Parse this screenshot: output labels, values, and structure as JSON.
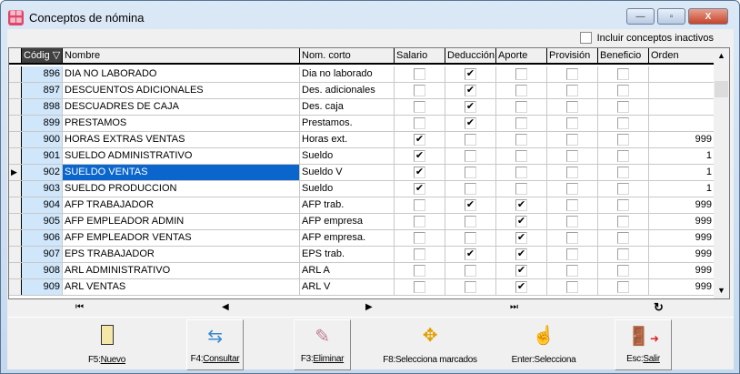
{
  "window": {
    "title": "Conceptos de nómina",
    "minimize": "—",
    "restore": "▫",
    "close": "X"
  },
  "filter": {
    "inactive_label": "Incluir conceptos inactivos",
    "inactive_checked": false
  },
  "grid": {
    "columns": [
      "Códig ▽",
      "Nombre",
      "Nom. corto",
      "Salario",
      "Deducción",
      "Aporte",
      "Provisión",
      "Beneficio",
      "Orden"
    ],
    "selected_code": "902",
    "rows": [
      {
        "code": "896",
        "name": "DIA NO LABORADO",
        "short": "Dia no laborado",
        "salario": false,
        "deduccion": true,
        "aporte": false,
        "provision": false,
        "beneficio": false,
        "orden": ""
      },
      {
        "code": "897",
        "name": "DESCUENTOS ADICIONALES",
        "short": "Des. adicionales",
        "salario": false,
        "deduccion": true,
        "aporte": false,
        "provision": false,
        "beneficio": false,
        "orden": ""
      },
      {
        "code": "898",
        "name": "DESCUADRES DE CAJA",
        "short": "Des. caja",
        "salario": false,
        "deduccion": true,
        "aporte": false,
        "provision": false,
        "beneficio": false,
        "orden": ""
      },
      {
        "code": "899",
        "name": "PRESTAMOS",
        "short": "Prestamos.",
        "salario": false,
        "deduccion": true,
        "aporte": false,
        "provision": false,
        "beneficio": false,
        "orden": ""
      },
      {
        "code": "900",
        "name": "HORAS EXTRAS VENTAS",
        "short": "Horas ext.",
        "salario": true,
        "deduccion": false,
        "aporte": false,
        "provision": false,
        "beneficio": false,
        "orden": "999"
      },
      {
        "code": "901",
        "name": "SUELDO ADMINISTRATIVO",
        "short": "Sueldo",
        "salario": true,
        "deduccion": false,
        "aporte": false,
        "provision": false,
        "beneficio": false,
        "orden": "1"
      },
      {
        "code": "902",
        "name": "SUELDO VENTAS",
        "short": "Sueldo V",
        "salario": true,
        "deduccion": false,
        "aporte": false,
        "provision": false,
        "beneficio": false,
        "orden": "1"
      },
      {
        "code": "903",
        "name": "SUELDO PRODUCCION",
        "short": "Sueldo",
        "salario": true,
        "deduccion": false,
        "aporte": false,
        "provision": false,
        "beneficio": false,
        "orden": "1"
      },
      {
        "code": "904",
        "name": "AFP TRABAJADOR",
        "short": "AFP trab.",
        "salario": false,
        "deduccion": true,
        "aporte": true,
        "provision": false,
        "beneficio": false,
        "orden": "999"
      },
      {
        "code": "905",
        "name": "AFP EMPLEADOR ADMIN",
        "short": "AFP empresa",
        "salario": false,
        "deduccion": false,
        "aporte": true,
        "provision": false,
        "beneficio": false,
        "orden": "999"
      },
      {
        "code": "906",
        "name": "AFP EMPLEADOR VENTAS",
        "short": "AFP empresa.",
        "salario": false,
        "deduccion": false,
        "aporte": true,
        "provision": false,
        "beneficio": false,
        "orden": "999"
      },
      {
        "code": "907",
        "name": "EPS TRABAJADOR",
        "short": "EPS trab.",
        "salario": false,
        "deduccion": true,
        "aporte": true,
        "provision": false,
        "beneficio": false,
        "orden": "999"
      },
      {
        "code": "908",
        "name": "ARL ADMINISTRATIVO",
        "short": "ARL A",
        "salario": false,
        "deduccion": false,
        "aporte": true,
        "provision": false,
        "beneficio": false,
        "orden": "999"
      },
      {
        "code": "909",
        "name": "ARL VENTAS",
        "short": "ARL V",
        "salario": false,
        "deduccion": false,
        "aporte": true,
        "provision": false,
        "beneficio": false,
        "orden": "999"
      }
    ]
  },
  "nav": {
    "first": "⏮",
    "prev": "◀",
    "next": "▶",
    "last": "⏭",
    "refresh": "↻"
  },
  "toolbar": {
    "nuevo": {
      "key": "F5:",
      "label": "Nuevo"
    },
    "consultar": {
      "key": "F4:",
      "label": "Consultar"
    },
    "eliminar": {
      "key": "F3:",
      "label": "Eliminar"
    },
    "marcados": "F8:Selecciona marcados",
    "selecciona": "Enter:Selecciona",
    "salir": {
      "key": "Esc:",
      "label": "Salir"
    }
  }
}
